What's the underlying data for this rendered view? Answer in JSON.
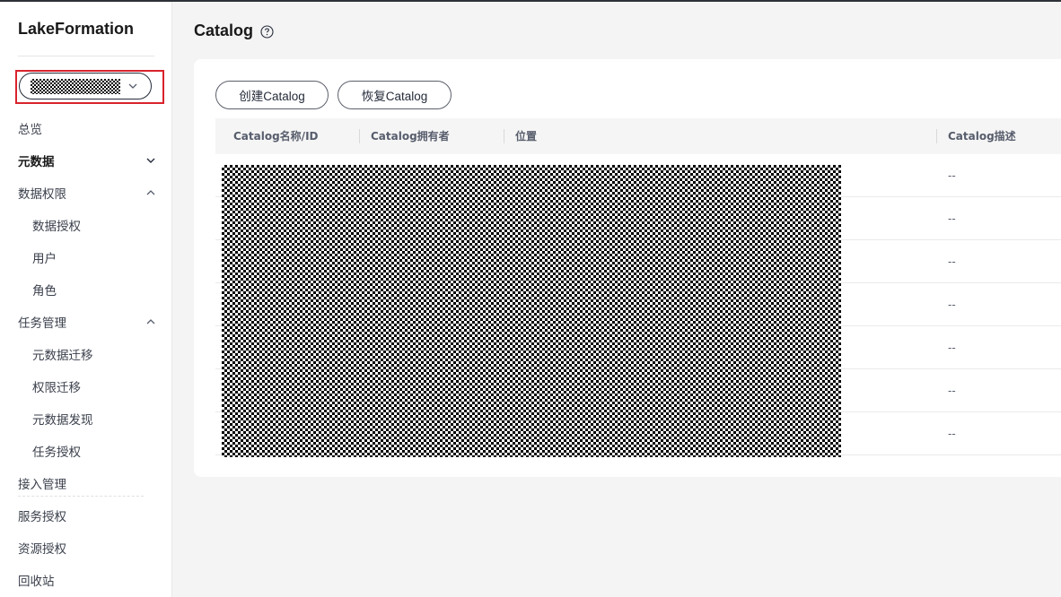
{
  "app": {
    "title": "LakeFormation"
  },
  "sidebar": {
    "selector": {
      "icon": "chevron-down-icon"
    },
    "nav": [
      {
        "label": "总览"
      },
      {
        "label": "元数据",
        "active": true,
        "icon": "chevron-down-icon"
      },
      {
        "label": "数据权限",
        "icon": "chevron-up-icon"
      },
      {
        "label": "数据授权"
      },
      {
        "label": "用户"
      },
      {
        "label": "角色"
      },
      {
        "label": "任务管理",
        "icon": "chevron-up-icon"
      },
      {
        "label": "元数据迁移"
      },
      {
        "label": "权限迁移"
      },
      {
        "label": "元数据发现"
      },
      {
        "label": "任务授权"
      },
      {
        "label": "接入管理"
      },
      {
        "label": "服务授权"
      },
      {
        "label": "资源授权"
      },
      {
        "label": "回收站"
      }
    ]
  },
  "main": {
    "title": "Catalog",
    "help_icon": "question-circle-icon",
    "buttons": {
      "create": "创建Catalog",
      "restore": "恢复Catalog"
    },
    "table": {
      "columns": [
        "Catalog名称/ID",
        "Catalog拥有者",
        "位置",
        "Catalog描述"
      ],
      "rows": [
        {
          "description": "--"
        },
        {
          "description": "--"
        },
        {
          "description": "--"
        },
        {
          "description": "--"
        },
        {
          "description": "--"
        },
        {
          "description": "--"
        },
        {
          "description": "--"
        }
      ]
    }
  },
  "colors": {
    "highlight_border": "#d9232c",
    "sidebar_bg": "#ffffff",
    "page_bg": "#f4f4f4",
    "table_header_bg": "#f5f5f5"
  }
}
